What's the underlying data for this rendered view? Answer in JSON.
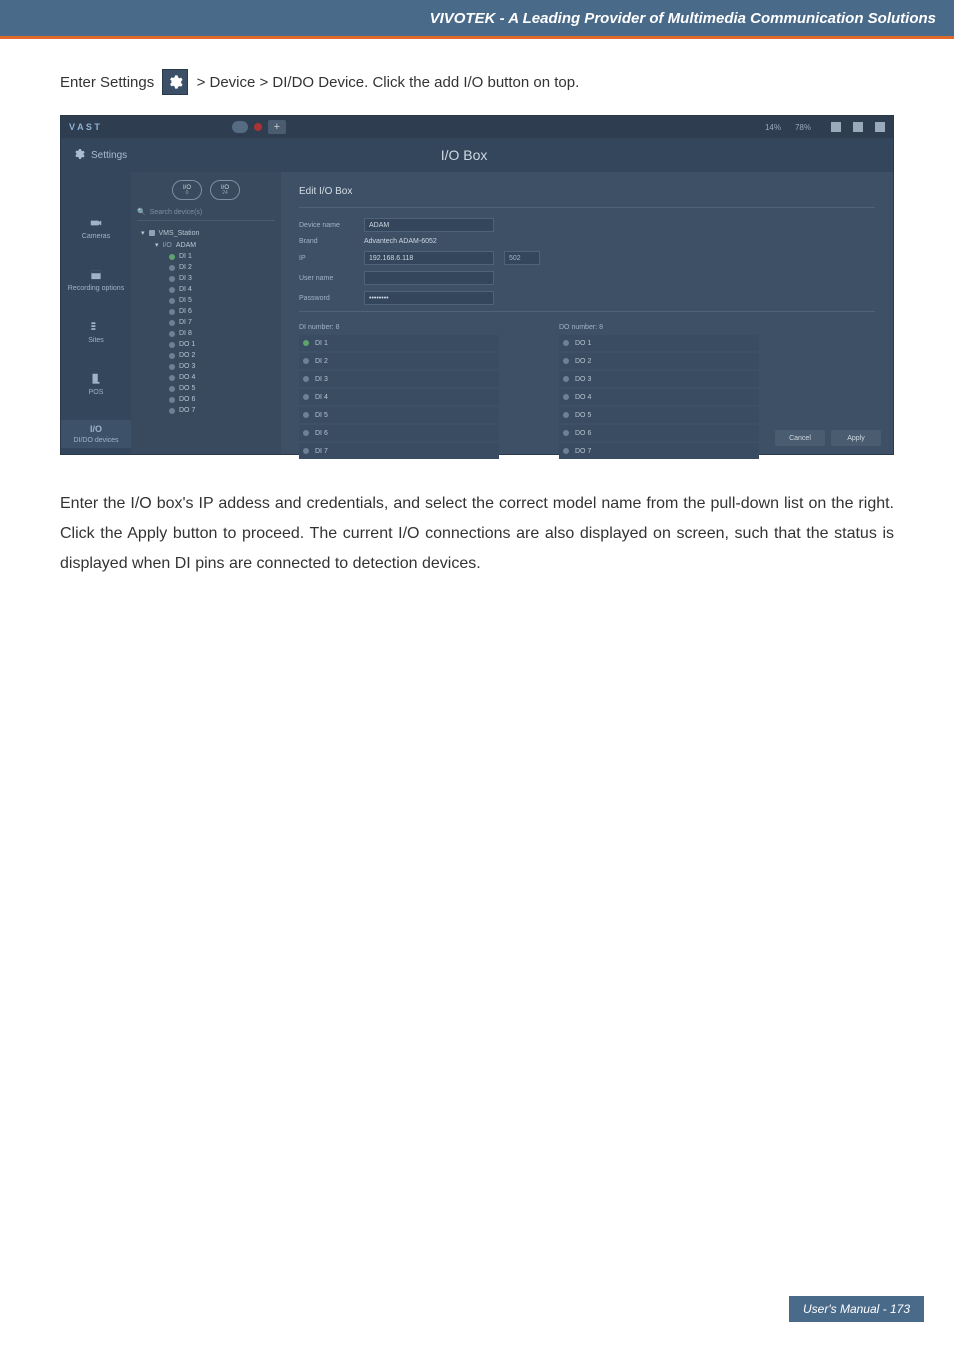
{
  "banner": {
    "title": "VIVOTEK - A Leading Provider of Multimedia Communication Solutions"
  },
  "intro": {
    "before": "Enter Settings ",
    "after": " > Device > DI/DO Device. Click the add I/O button on top."
  },
  "shot": {
    "logo": "V A S T",
    "plus": "+",
    "status_left": "14%",
    "status_right": "78%",
    "settings_label": "Settings",
    "header_center": "I/O Box",
    "io_toggle_a": {
      "top": "I/O",
      "sub": "0"
    },
    "io_toggle_b": {
      "top": "I/O",
      "sub": "24"
    },
    "search_placeholder": "Search device(s)",
    "rail": [
      {
        "label": "Cameras"
      },
      {
        "label": "Recording options"
      },
      {
        "label": "Sites"
      },
      {
        "label": "POS"
      },
      {
        "label": "I/O",
        "active": true,
        "sub": "DI/DO devices"
      }
    ],
    "tree": {
      "root": "VMS_Station",
      "device": "ADAM",
      "items": [
        "DI 1",
        "DI 2",
        "DI 3",
        "DI 4",
        "DI 5",
        "DI 6",
        "DI 7",
        "DI 8",
        "DO 1",
        "DO 2",
        "DO 3",
        "DO 4",
        "DO 5",
        "DO 6",
        "DO 7"
      ]
    },
    "panel": {
      "title": "Edit I/O Box",
      "device_name_lbl": "Device name",
      "device_name_val": "ADAM",
      "brand_lbl": "Brand",
      "brand_val": "Advantech  ADAM-6052",
      "ip_lbl": "IP",
      "ip_val": "192.168.6.118",
      "port_val": "502",
      "user_lbl": "User name",
      "pass_lbl": "Password",
      "pass_val": "••••••••",
      "di_title": "DI number: 8",
      "do_title": "DO number: 8",
      "di": [
        "DI 1",
        "DI 2",
        "DI 3",
        "DI 4",
        "DI 5",
        "DI 6",
        "DI 7"
      ],
      "do": [
        "DO 1",
        "DO 2",
        "DO 3",
        "DO 4",
        "DO 5",
        "DO 6",
        "DO 7"
      ],
      "apply": "Apply",
      "cancel": "Cancel"
    }
  },
  "paragraph": "Enter the I/O box's IP addess and credentials, and select the correct model name from the pull-down list on the right. Click the Apply button to proceed. The current I/O connections are also displayed on screen, such that the status is displayed when DI pins are connected to detection devices.",
  "footer": "User's Manual - 173"
}
